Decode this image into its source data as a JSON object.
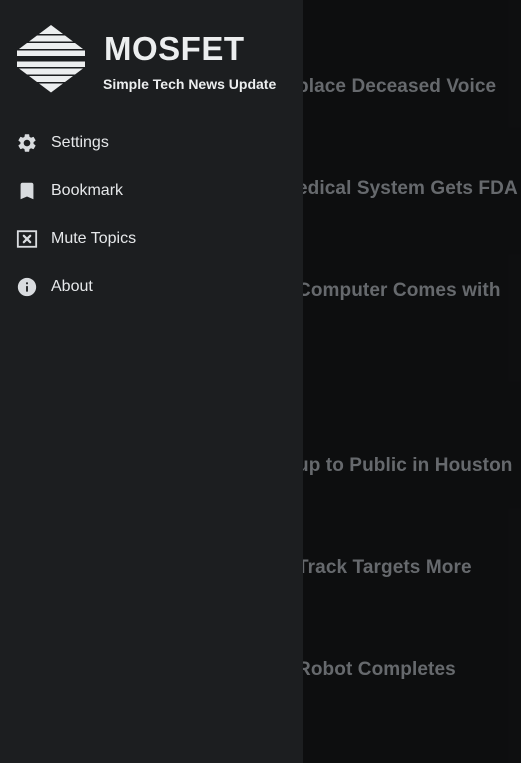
{
  "app": {
    "name": "MOSFET",
    "tagline": "Simple Tech News Update"
  },
  "menu": [
    {
      "label": "Settings",
      "icon": "gear-icon"
    },
    {
      "label": "Bookmark",
      "icon": "bookmark-icon"
    },
    {
      "label": "Mute Topics",
      "icon": "mute-box-icon"
    },
    {
      "label": "About",
      "icon": "info-icon"
    }
  ],
  "feed": {
    "headlines": [
      "place Deceased Voice",
      "edical System Gets FDA",
      "Computer Comes with",
      "up to Public in Houston",
      "Track Targets More",
      "Robot Completes"
    ]
  },
  "colors": {
    "drawer_bg": "#1c1e20",
    "feed_bg": "#111213",
    "text": "#e6e8ea",
    "headline_text": "#7d8185"
  }
}
